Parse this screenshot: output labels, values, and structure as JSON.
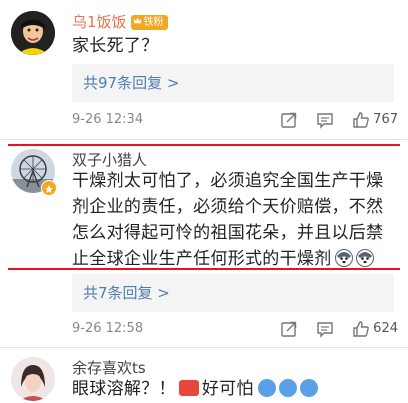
{
  "comments": [
    {
      "username": "乌1饭饭",
      "badge": "铁粉",
      "text": "家长死了？",
      "replies": "共97条回复 >",
      "time": "9-26 12:34",
      "likes": "767"
    },
    {
      "username": "双子小猎人",
      "text": "干燥剂太可怕了，必须追究全国生产干燥剂企业的责任，必须给个天价赔偿，不然怎么对得起可怜的祖国花朵，并且以后禁止全球企业生产任何形式的干燥剂",
      "replies": "共7条回复 >",
      "time": "9-26 12:58",
      "likes": "624"
    },
    {
      "username": "余存喜欢ts",
      "text_part1": "眼球溶解？！",
      "text_part2": "好可怕"
    }
  ],
  "colors": {
    "highlight": "#e8131f",
    "username_vip": "#eb7350",
    "link": "#507daf"
  },
  "icons": [
    "share-icon",
    "comment-icon",
    "like-icon",
    "crown-icon",
    "husky-emoji"
  ]
}
